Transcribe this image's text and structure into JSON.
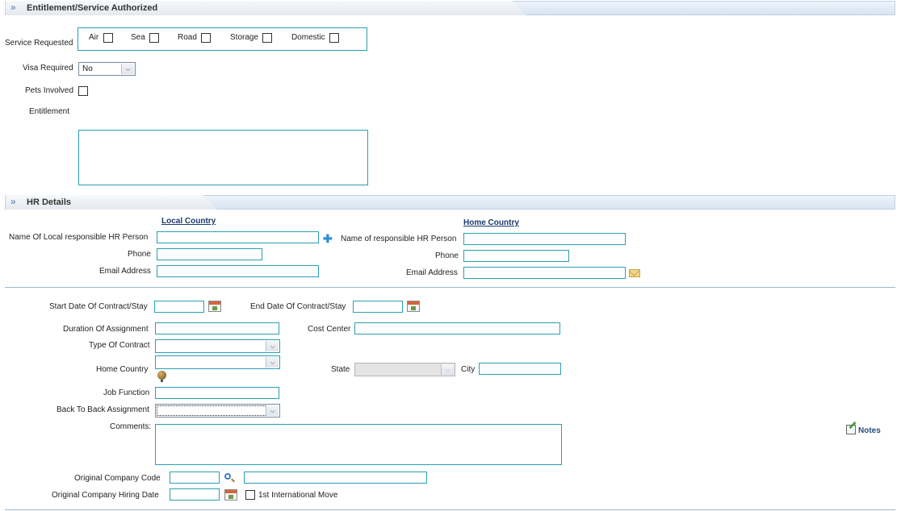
{
  "entitlement_section": {
    "title": "Entitlement/Service Authorized",
    "service_requested_label": "Service Requested",
    "services": [
      "Air",
      "Sea",
      "Road",
      "Storage",
      "Domestic"
    ],
    "visa_required_label": "Visa Required",
    "visa_required_value": "No",
    "pets_involved_label": "Pets Involved",
    "entitlement_label": "Entitlement"
  },
  "hr_section": {
    "title": "HR Details",
    "local_country_label": "Local Country",
    "home_country_label": "Home Country",
    "local_hr_person_label": "Name Of Local responsible HR Person",
    "home_hr_person_label": "Name of responsible HR Person",
    "phone_label": "Phone",
    "email_label": "Email Address"
  },
  "contract": {
    "start_date_label": "Start Date Of Contract/Stay",
    "end_date_label": "End Date Of Contract/Stay",
    "duration_label": "Duration Of Assignment",
    "cost_center_label": "Cost Center",
    "type_of_contract_label": "Type Of Contract",
    "home_country_label": "Home Country",
    "state_label": "State",
    "city_label": "City",
    "job_function_label": "Job Function",
    "back_to_back_label": "Back To Back Assignment",
    "comments_label": "Comments:",
    "notes_label": "Notes",
    "original_company_code_label": "Original Company Code",
    "original_company_hiring_date_label": "Original Company Hiring Date",
    "first_international_move_label": "1st International Move"
  },
  "icons": {
    "section_chevron": "double-chevron-right-icon",
    "calendar": "calendar-icon",
    "add": "plus-icon",
    "email": "envelope-icon",
    "globe": "globe-icon",
    "search": "magnifier-icon",
    "notes": "notes-icon"
  },
  "colors": {
    "field_border": "#2a9fb0",
    "section_bar": "#d7e4f1",
    "link_text": "#1a3a6e"
  }
}
